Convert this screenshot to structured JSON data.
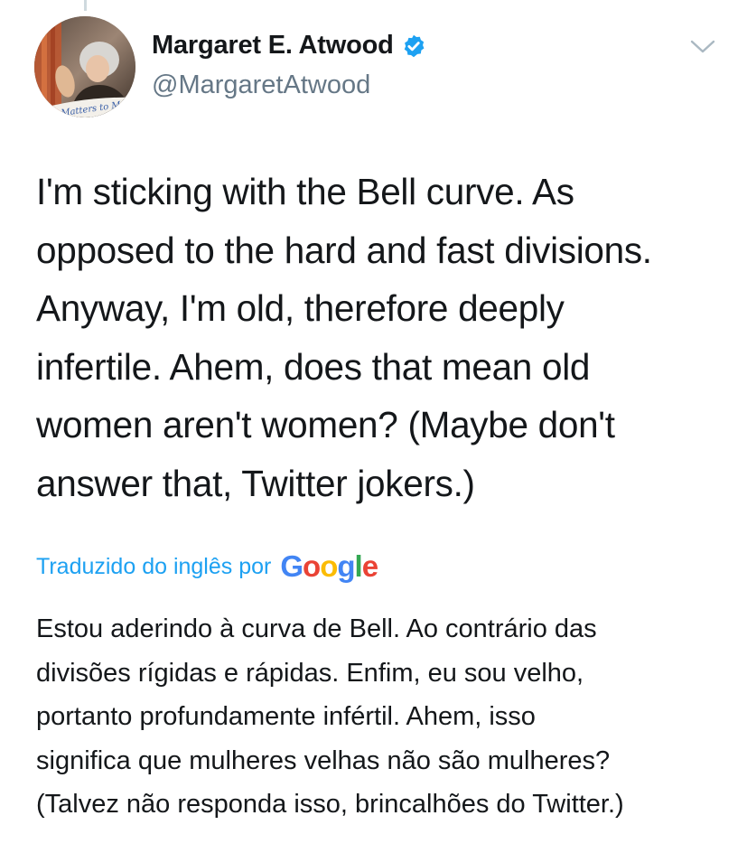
{
  "author": {
    "display_name": "Margaret E. Atwood",
    "handle": "@MargaretAtwood",
    "verified": true,
    "avatar_caption": "It Matters to Me"
  },
  "tweet": {
    "text": "I'm sticking with the Bell curve. As\nopposed to the hard and fast divisions.\nAnyway, I'm old, therefore deeply\ninfertile. Ahem, does that mean old\nwomen aren't women?  (Maybe don't\nanswer that, Twitter jokers.)"
  },
  "translation": {
    "label": "Traduzido do inglês por",
    "provider": "Google",
    "text": "Estou aderindo à curva de Bell. Ao contrário das\ndivisões rígidas e rápidas. Enfim, eu sou velho,\nportanto profundamente infértil. Ahem, isso\nsignifica que mulheres velhas não são mulheres?\n(Talvez não responda isso, brincalhões do Twitter.)"
  },
  "icons": {
    "verified": "verified-badge-icon",
    "menu": "chevron-down-icon"
  },
  "colors": {
    "link_blue": "#1da1f2",
    "secondary_text": "#657786",
    "primary_text": "#14171a",
    "google_blue": "#4285F4",
    "google_red": "#EA4335",
    "google_yellow": "#FBBC05",
    "google_green": "#34A853"
  }
}
